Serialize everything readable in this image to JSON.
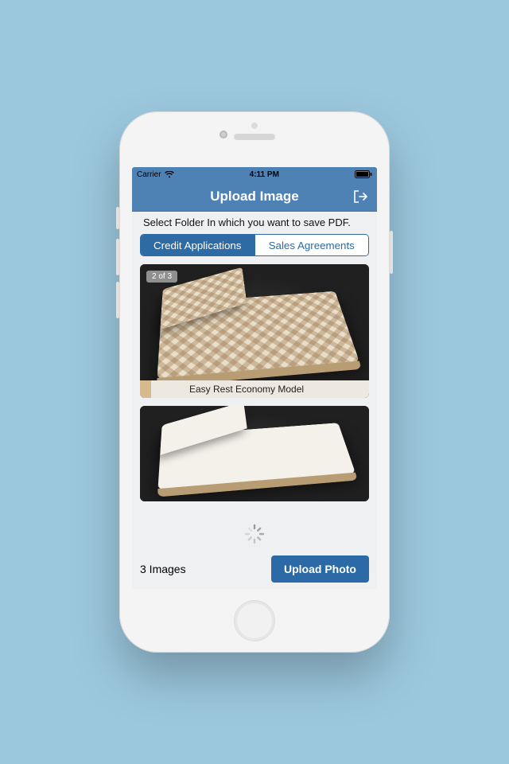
{
  "status": {
    "carrier": "Carrier",
    "time": "4:11 PM"
  },
  "nav": {
    "title": "Upload Image"
  },
  "prompt": "Select Folder In which you want to save PDF.",
  "tabs": {
    "credit": "Credit Applications",
    "sales": "Sales Agreements",
    "active": "credit"
  },
  "gallery": {
    "badge": "2 of 3",
    "item1_caption": "Easy Rest Economy Model"
  },
  "footer": {
    "count_label": "3 Images",
    "upload_label": "Upload Photo"
  }
}
